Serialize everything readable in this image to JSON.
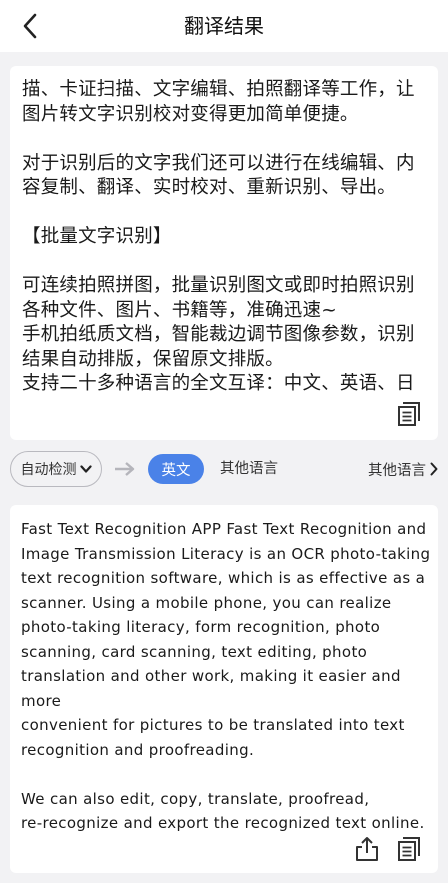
{
  "header": {
    "title": "翻译结果",
    "back_icon": "chevron-left-icon"
  },
  "source": {
    "lines": [
      "描、卡证扫描、文字编辑、拍照翻译等工作，让",
      "图片转文字识别校对变得更加简单便捷。",
      "",
      "对于识别后的文字我们还可以进行在线编辑、内",
      "容复制、翻译、实时校对、重新识别、导出。",
      "",
      "【批量文字识别】",
      "",
      "可连续拍照拼图，批量识别图文或即时拍照识别",
      "各种文件、图片、书籍等，准确迅速~",
      "手机拍纸质文档，智能裁边调节图像参数，识别",
      "结果自动排版，保留原文排版。",
      "支持二十多种语言的全文互译：中文、英语、日"
    ],
    "copy_icon": "copy-icon"
  },
  "lang_bar": {
    "detect_label": "自动检测",
    "active_label": "英文",
    "other_label": "其他语言",
    "more_label": "其他语言",
    "accent": "#4a82e8"
  },
  "result": {
    "lines": [
      "Fast Text Recognition APP Fast Text Recognition and",
      "Image Transmission Literacy is an OCR photo-taking",
      "text recognition software, which is as effective as a",
      "scanner. Using a mobile phone, you can realize",
      "photo-taking literacy, form recognition, photo",
      "scanning, card scanning, text editing, photo",
      "translation and other work, making it easier and more",
      "convenient for pictures to be translated into text",
      "recognition and proofreading.",
      "",
      "We can also edit, copy, translate, proofread,",
      "re-recognize and export the recognized text online."
    ],
    "share_icon": "share-icon",
    "copy_icon": "copy-icon"
  }
}
